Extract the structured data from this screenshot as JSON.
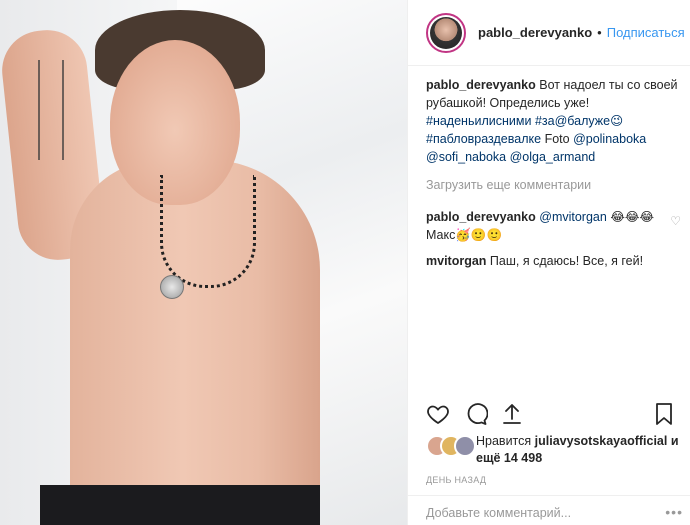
{
  "post": {
    "username": "pablo_derevyanko",
    "follow_label": "Подписаться",
    "caption": {
      "text1": "Вот надоел ты со своей рубашкой! Определись уже!",
      "tag1": "#наденьилисними",
      "tag2": "#за@балуже😉",
      "tag3": "#пабловраздевалке",
      "foto_word": "Foto",
      "mention1": "@polinaboka",
      "mention2": "@sofi_naboka",
      "mention3": "@olga_armand"
    },
    "load_more_label": "Загрузить еще комментарии",
    "comments": [
      {
        "user": "pablo_derevyanko",
        "mention": "@mvitorgan",
        "text": "😂😂😂 Макс🥳🙂🙂"
      },
      {
        "user": "mvitorgan",
        "text": "Паш, я сдаюсь! Все, я гей!"
      }
    ],
    "likes": {
      "label": "Нравится",
      "user": "juliavysotskayaofficial",
      "rest": "и ещё 14 498"
    },
    "time_label": "ДЕНЬ НАЗАД",
    "add_comment_placeholder": "Добавьте комментарий...",
    "icons": {
      "like": "heart-icon",
      "comment": "comment-icon",
      "share": "share-icon",
      "save": "bookmark-icon",
      "comment_like": "heart-small-icon",
      "more": "more-options-icon"
    }
  }
}
